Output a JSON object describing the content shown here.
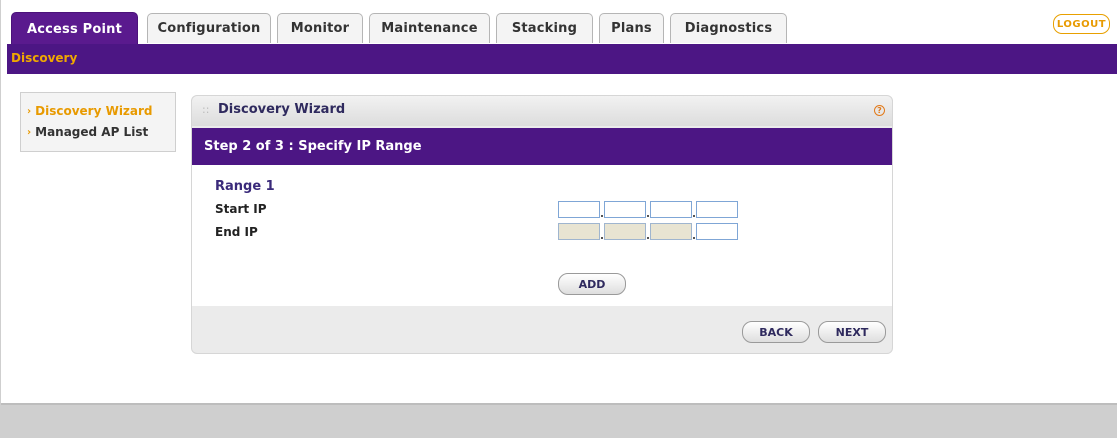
{
  "tabs": [
    {
      "label": "Access Point",
      "active": true
    },
    {
      "label": "Configuration",
      "active": false
    },
    {
      "label": "Monitor",
      "active": false
    },
    {
      "label": "Maintenance",
      "active": false
    },
    {
      "label": "Stacking",
      "active": false
    },
    {
      "label": "Plans",
      "active": false
    },
    {
      "label": "Diagnostics",
      "active": false
    }
  ],
  "logout_label": "LOGOUT",
  "subnav": {
    "label": "Discovery"
  },
  "sidebar": {
    "items": [
      {
        "label": "Discovery Wizard",
        "active": true
      },
      {
        "label": "Managed AP List",
        "active": false
      }
    ]
  },
  "panel": {
    "title": "Discovery Wizard",
    "step": "Step 2 of 3 : Specify IP Range",
    "range_title": "Range 1",
    "start_ip_label": "Start IP",
    "end_ip_label": "End IP",
    "add_label": "ADD",
    "back_label": "BACK",
    "next_label": "NEXT"
  },
  "colors": {
    "brand_purple": "#4c1684",
    "accent_orange": "#e89a00"
  }
}
